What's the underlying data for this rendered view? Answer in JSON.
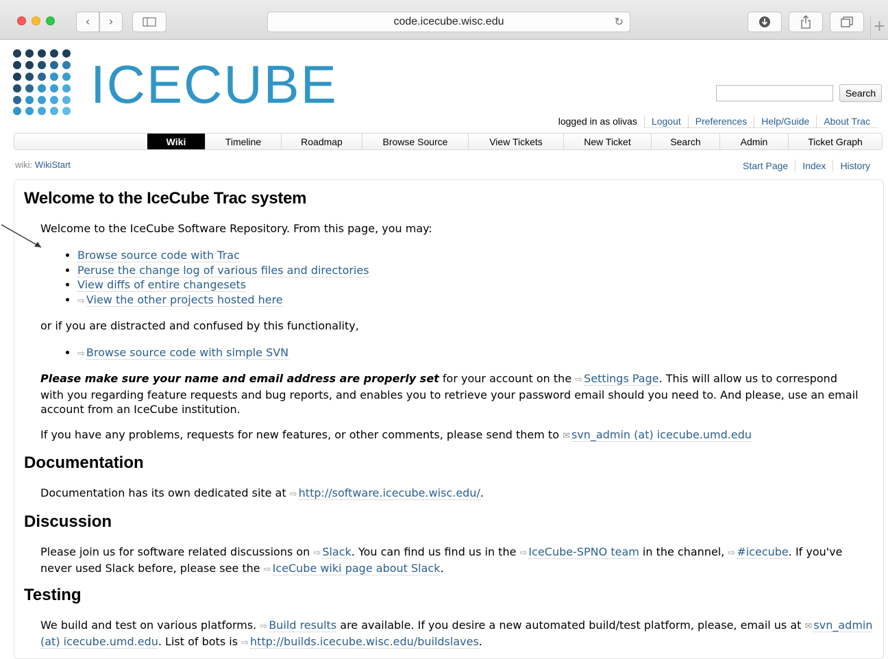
{
  "browser": {
    "url": "code.icecube.wisc.edu"
  },
  "header": {
    "logo_text": "ICECUBE",
    "search_button": "Search",
    "metanav": {
      "logged_in": "logged in as olivas",
      "links": [
        "Logout",
        "Preferences",
        "Help/Guide",
        "About Trac"
      ]
    }
  },
  "mainnav": [
    "Wiki",
    "Timeline",
    "Roadmap",
    "Browse Source",
    "View Tickets",
    "New Ticket",
    "Search",
    "Admin",
    "Ticket Graph"
  ],
  "context": {
    "prefix": "wiki:",
    "page": "WikiStart",
    "links": [
      "Start Page",
      "Index",
      "History"
    ]
  },
  "content": {
    "title": "Welcome to the IceCube Trac system",
    "intro": "Welcome to the IceCube Software Repository. From this page, you may:",
    "list1": [
      "Browse source code with Trac",
      "Peruse the change log of various files and directories",
      "View diffs of entire changesets",
      "View the other projects hosted here"
    ],
    "or_text": "or if you are distracted and confused by this functionality,",
    "list2": [
      "Browse source code with simple SVN"
    ],
    "notice_bold": "Please make sure your name and email address are properly set",
    "notice_a": " for your account on the ",
    "notice_link": "Settings Page",
    "notice_b": ". This will allow us to correspond with you regarding feature requests and bug reports, and enables you to retrieve your password email should you need to. And please, use an email account from an IceCube institution.",
    "problems_text": "If you have any problems, requests for new features, or other comments, please send them to ",
    "email": "svn_admin (at) icecube.umd.edu",
    "doc_heading": "Documentation",
    "doc_text": "Documentation has its own dedicated site at ",
    "doc_link": "http://software.icecube.wisc.edu/",
    "doc_end": ".",
    "disc_heading": "Discussion",
    "disc_a": "Please join us for software related discussions on ",
    "disc_slack": "Slack",
    "disc_b": ". You can find us find us in the ",
    "disc_team": "IceCube-SPNO team",
    "disc_c": " in the channel, ",
    "disc_channel": "#icecube",
    "disc_d": ". If you've never used Slack before, please see the ",
    "disc_wiki": "IceCube wiki page about Slack",
    "disc_e": ".",
    "test_heading": "Testing",
    "test_a": "We build and test on various platforms. ",
    "test_results": "Build results",
    "test_b": " are available. If you desire a new automated build/test platform, please, email us at ",
    "test_email": "svn_admin (at) icecube.umd.edu",
    "test_c": ". List of bots is ",
    "test_bots": "http://builds.icecube.wisc.edu/buildslaves",
    "test_d": "."
  },
  "colors": {
    "brand": "#3195c6",
    "link": "#2a5f8f"
  },
  "icons": [
    "back-icon",
    "forward-icon",
    "sidebar-icon",
    "reload-icon",
    "download-icon",
    "share-icon",
    "tabs-icon",
    "external-link-icon",
    "email-icon"
  ]
}
